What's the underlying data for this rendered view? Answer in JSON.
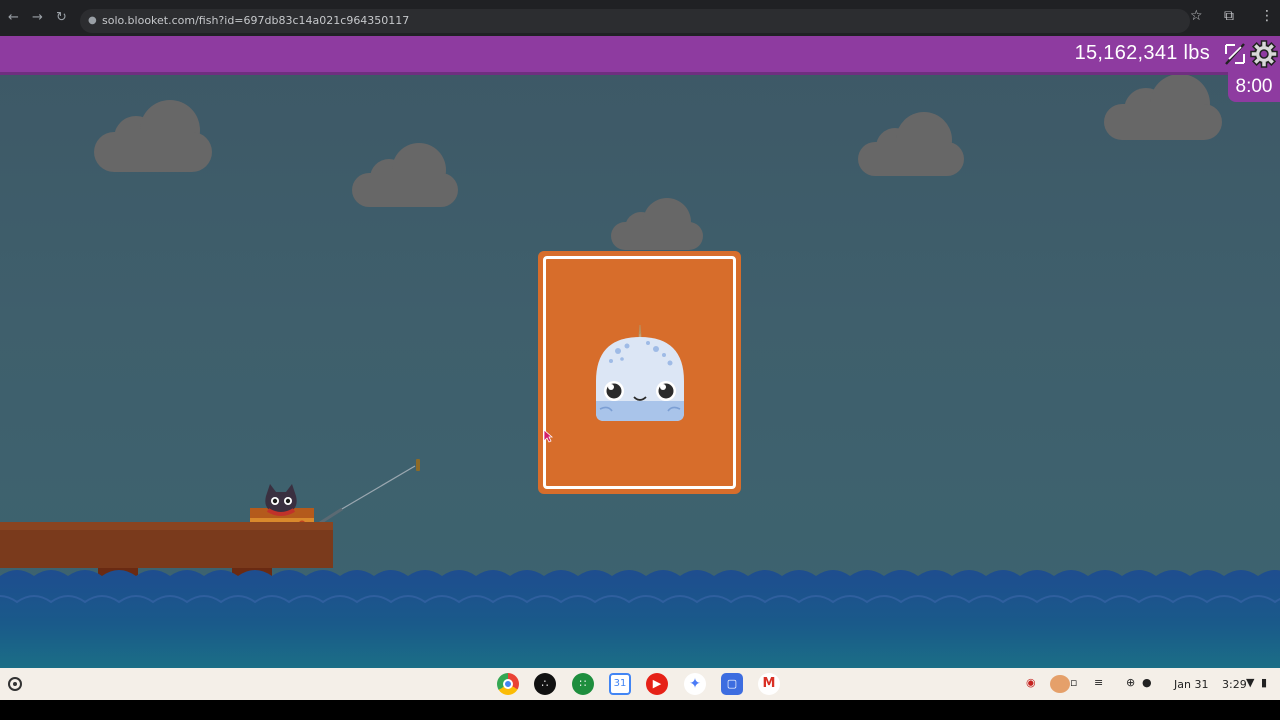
{
  "browser": {
    "url": "solo.blooket.com/fish?id=697db83c14a021c964350117",
    "back_icon": "back-arrow-icon",
    "forward_icon": "forward-arrow-icon",
    "reload_icon": "reload-icon",
    "bookmark_icon": "star-icon",
    "extensions_icon": "puzzle-icon",
    "menu_icon": "kebab-menu-icon"
  },
  "game": {
    "weight": "15,162,341 lbs",
    "timer": "8:00",
    "colors": {
      "top_bar": "#8e3ba0",
      "card": "#d76d2b",
      "sky": "#3f5d6a",
      "water": "#1f4f8a"
    },
    "card_creature": "narwhal-blook"
  },
  "taskbar": {
    "apps": [
      "chrome-icon",
      "audible-icon",
      "google-classroom-icon",
      "google-calendar-icon",
      "youtube-icon",
      "gemini-icon",
      "docs-icon",
      "gmail-icon"
    ],
    "date": "Jan 31",
    "time": "3:29"
  }
}
